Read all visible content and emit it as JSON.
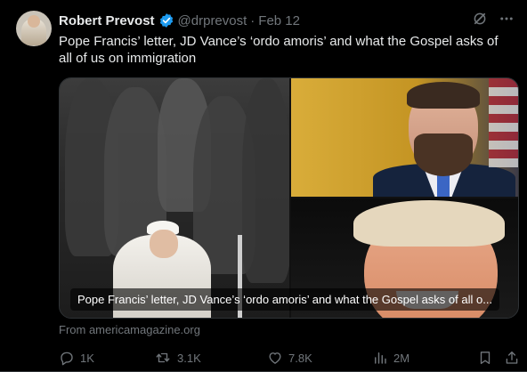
{
  "post": {
    "author_name": "Robert Prevost",
    "handle": "@drprevost",
    "separator": "·",
    "date": "Feb 12",
    "text": "Pope Francis’ letter, JD Vance’s ‘ordo amoris’ and what the Gospel asks of all of us on immigration"
  },
  "card": {
    "caption": "Pope Francis’ letter, JD Vance’s ‘ordo amoris’ and what the Gospel asks of all o...",
    "from_text": "From americamagazine.org"
  },
  "actions": {
    "replies": "1K",
    "reposts": "3.1K",
    "likes": "7.8K",
    "views": "2M"
  },
  "colors": {
    "background": "#000000",
    "text": "#e7e9ea",
    "muted": "#71767b",
    "verified": "#1d9bf0"
  },
  "icons": [
    "verified-badge-icon",
    "grok-icon",
    "more-icon",
    "reply-icon",
    "repost-icon",
    "like-icon",
    "views-icon",
    "bookmark-icon",
    "share-icon"
  ]
}
